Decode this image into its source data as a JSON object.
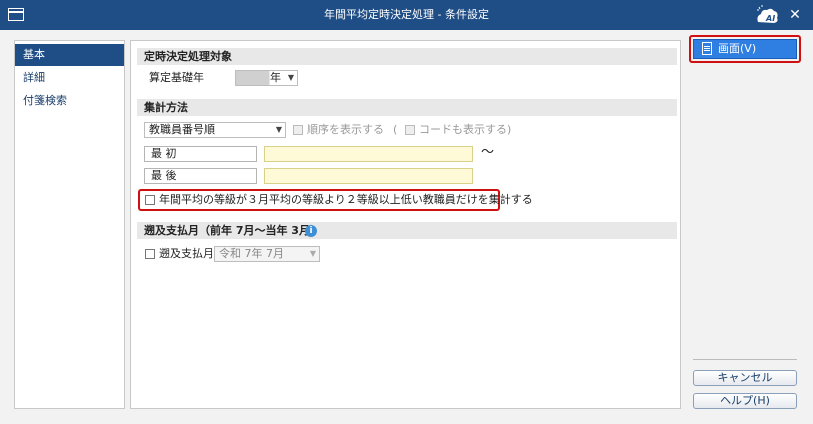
{
  "window": {
    "title": "年間平均定時決定処理 - 条件設定"
  },
  "sidebar": {
    "items": [
      {
        "label": "基本"
      },
      {
        "label": "詳細"
      },
      {
        "label": "付箋検索"
      }
    ]
  },
  "section1": {
    "heading": "定時決定処理対象",
    "base_year_label": "算定基礎年",
    "base_year_value": "年"
  },
  "section2": {
    "heading": "集計方法",
    "order_select": "教職員番号順",
    "show_order_label": "順序を表示する",
    "paren_open": "(",
    "show_code_label": "コードも表示する",
    "paren_close": ")",
    "first_label": "最 初",
    "last_label": "最 後",
    "tilde": "～",
    "grade_check_label": "年間平均の等級が３月平均の等級より２等級以上低い教職員だけを集計する"
  },
  "section3": {
    "heading": "遡及支払月（前年 7月～当年 3月）",
    "retro_label": "遡及支払月",
    "retro_month": "令和 7年 7月"
  },
  "buttons": {
    "screen": "画面(V)",
    "cancel": "キャンセル",
    "help": "ヘルプ(H)"
  },
  "colors": {
    "titlebar": "#1f4e86",
    "accent": "#2f7fe3",
    "highlight": "#d01010",
    "input_bg": "#fefad8"
  }
}
